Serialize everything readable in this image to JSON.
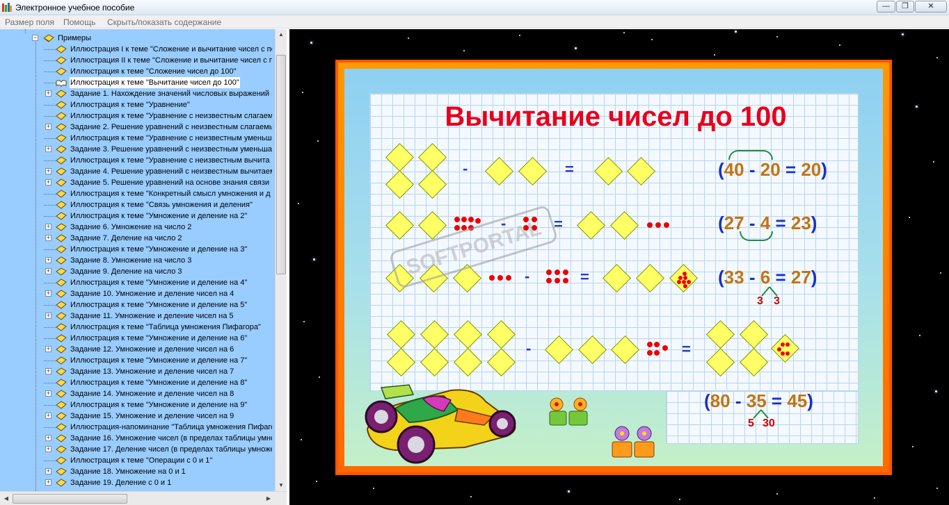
{
  "window": {
    "title": "Электронное учебное пособие",
    "controls": {
      "minimize": "—",
      "maximize": "❐",
      "close": "✕"
    }
  },
  "menu": [
    "Размер поля",
    "Помощь",
    "Скрыть/показать содержание"
  ],
  "tree": {
    "root_label": "Примеры",
    "items": [
      {
        "label": "Иллюстрация I к теме \"Сложение и вычитание чисел с пе",
        "expandable": false,
        "icon": "book-icon"
      },
      {
        "label": "Иллюстрация II к теме \"Сложение и вычитание чисел с п",
        "expandable": false,
        "icon": "book-icon"
      },
      {
        "label": "Иллюстрация к теме \"Сложение чисел до 100\"",
        "expandable": false,
        "icon": "book-icon"
      },
      {
        "label": "Иллюстрация к теме \"Вычитание чисел до 100\"",
        "expandable": false,
        "icon": "open-book-icon",
        "selected": true
      },
      {
        "label": "Задание 1. Нахождение значений числовых выражений (",
        "expandable": true,
        "icon": "book-icon"
      },
      {
        "label": "Иллюстрация к теме \"Уравнение\"",
        "expandable": false,
        "icon": "book-icon"
      },
      {
        "label": "Иллюстрация к теме \"Уравнение с неизвестным слагаем",
        "expandable": false,
        "icon": "book-icon"
      },
      {
        "label": "Задание 2. Решение уравнений с неизвестным слагаемы",
        "expandable": true,
        "icon": "book-icon"
      },
      {
        "label": "Иллюстрация к теме \"Уравнение с неизвестным уменьш",
        "expandable": false,
        "icon": "book-icon"
      },
      {
        "label": "Задание 3. Решение уравнений с неизвестным уменьшае",
        "expandable": true,
        "icon": "book-icon"
      },
      {
        "label": "Иллюстрация к теме \"Уравнение с неизвестным вычита",
        "expandable": false,
        "icon": "book-icon"
      },
      {
        "label": "Задание 4. Решение уравнений с неизвестным вычитаем",
        "expandable": true,
        "icon": "book-icon"
      },
      {
        "label": "Задание 5. Решение уравнений на основе знания связи",
        "expandable": true,
        "icon": "book-icon"
      },
      {
        "label": "Иллюстрация к теме \"Конкретный смысл умножения и д",
        "expandable": false,
        "icon": "book-icon"
      },
      {
        "label": "Иллюстрация к теме \"Связь умножения и деления\"",
        "expandable": false,
        "icon": "book-icon"
      },
      {
        "label": "Иллюстрация к теме \"Умножение и деление на 2\"",
        "expandable": false,
        "icon": "book-icon"
      },
      {
        "label": "Задание 6. Умножение на число 2",
        "expandable": true,
        "icon": "book-icon"
      },
      {
        "label": "Задание 7. Деление на число 2",
        "expandable": true,
        "icon": "book-icon"
      },
      {
        "label": "Иллюстрация к теме \"Умножение и деление на 3\"",
        "expandable": false,
        "icon": "book-icon"
      },
      {
        "label": "Задание 8. Умножение на число 3",
        "expandable": true,
        "icon": "book-icon"
      },
      {
        "label": "Задание 9. Деление на число 3",
        "expandable": true,
        "icon": "book-icon"
      },
      {
        "label": "Иллюстрация к теме \"Умножение и деление на 4\"",
        "expandable": false,
        "icon": "book-icon"
      },
      {
        "label": "Задание 10. Умножение и деление чисел на 4",
        "expandable": true,
        "icon": "book-icon"
      },
      {
        "label": "Иллюстрация к теме \"Умножение и деление на 5\"",
        "expandable": false,
        "icon": "book-icon"
      },
      {
        "label": "Задание 11. Умножение и деление чисел на 5",
        "expandable": true,
        "icon": "book-icon"
      },
      {
        "label": "Иллюстрация к теме \"Таблица умножения Пифагора\"",
        "expandable": false,
        "icon": "book-icon"
      },
      {
        "label": "Иллюстрация к теме \"Умножение и деление на 6\"",
        "expandable": false,
        "icon": "book-icon"
      },
      {
        "label": "Задание 12. Умножение и деление чисел на 6",
        "expandable": true,
        "icon": "book-icon"
      },
      {
        "label": "Иллюстрация к теме \"Умножение и деление на 7\"",
        "expandable": false,
        "icon": "book-icon"
      },
      {
        "label": "Задание 13. Умножение и деление чисел на 7",
        "expandable": true,
        "icon": "book-icon"
      },
      {
        "label": "Иллюстрация к теме \"Умножение и деление на 8\"",
        "expandable": false,
        "icon": "book-icon"
      },
      {
        "label": "Задание 14. Умножение и деление чисел на 8",
        "expandable": true,
        "icon": "book-icon"
      },
      {
        "label": "Иллюстрация к теме \"Умножение и деление на 9\"",
        "expandable": false,
        "icon": "book-icon"
      },
      {
        "label": "Задание 15. Умножение и деление чисел на 9",
        "expandable": true,
        "icon": "book-icon"
      },
      {
        "label": "Иллюстрация-напоминание \"Таблица умножения Пифаго",
        "expandable": false,
        "icon": "book-icon"
      },
      {
        "label": "Задание 16. Умножение чисел (в пределах таблицы умно",
        "expandable": true,
        "icon": "book-icon"
      },
      {
        "label": "Задание 17. Деление чисел (в пределах таблицы умноже",
        "expandable": true,
        "icon": "book-icon"
      },
      {
        "label": "Иллюстрация к теме \"Операции с 0 и 1\"",
        "expandable": false,
        "icon": "book-icon"
      },
      {
        "label": "Задание 18. Умножение на 0 и 1",
        "expandable": true,
        "icon": "book-icon"
      },
      {
        "label": "Задание 19. Деление с 0 и 1",
        "expandable": true,
        "icon": "book-icon"
      }
    ]
  },
  "slide": {
    "title": "Вычитание чисел до 100",
    "equations": [
      {
        "lp": "(",
        "a": "40",
        "minus": "-",
        "b": "20",
        "eq": "=",
        "r": "20",
        "rp": ")"
      },
      {
        "lp": "(",
        "a": "27",
        "minus": "-",
        "b": "4",
        "eq": "=",
        "r": "23",
        "rp": ")"
      },
      {
        "lp": "(",
        "a": "33",
        "minus": "-",
        "b": "6",
        "eq": "=",
        "r": "27",
        "rp": ")",
        "split": [
          "3",
          "3"
        ]
      },
      {
        "lp": "(",
        "a": "80",
        "minus": "-",
        "b": "35",
        "eq": "=",
        "r": "45",
        "rp": ")",
        "split": [
          "5",
          "30"
        ]
      }
    ],
    "operators": {
      "minus": "-",
      "equals": "="
    },
    "watermark": "SOFTPORTAL"
  },
  "colors": {
    "tree_bg": "#99ccff",
    "title_red": "#e8001c",
    "operator_blue": "#1a2fc9",
    "number_orange": "#c27412",
    "frame_orange": "#ff7a00",
    "diamond_yellow": "#ffff66"
  }
}
